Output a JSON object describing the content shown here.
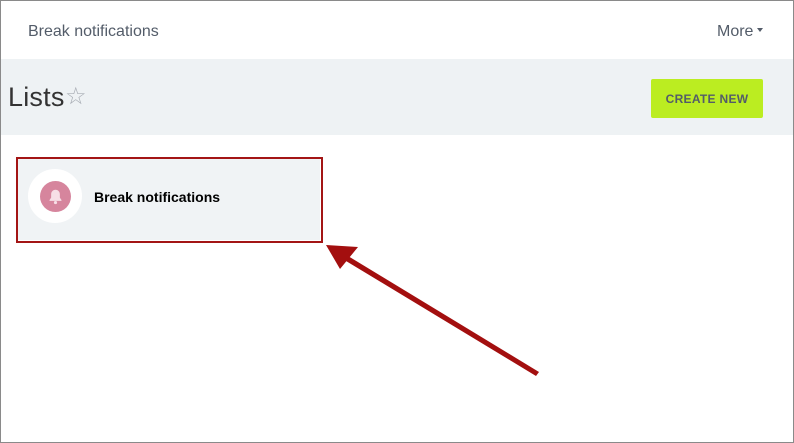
{
  "app": {
    "title": "Break notifications",
    "more_label": "More"
  },
  "header": {
    "title": "Lists",
    "star": "☆",
    "create_label": "CREATE NEW"
  },
  "lists": {
    "items": [
      {
        "label": "Break notifications",
        "icon": "bell-icon",
        "icon_color": "#d6859d"
      }
    ]
  },
  "colors": {
    "accent_button": "#bbed21",
    "header_band": "#eef2f4",
    "highlight": "#a31515"
  }
}
